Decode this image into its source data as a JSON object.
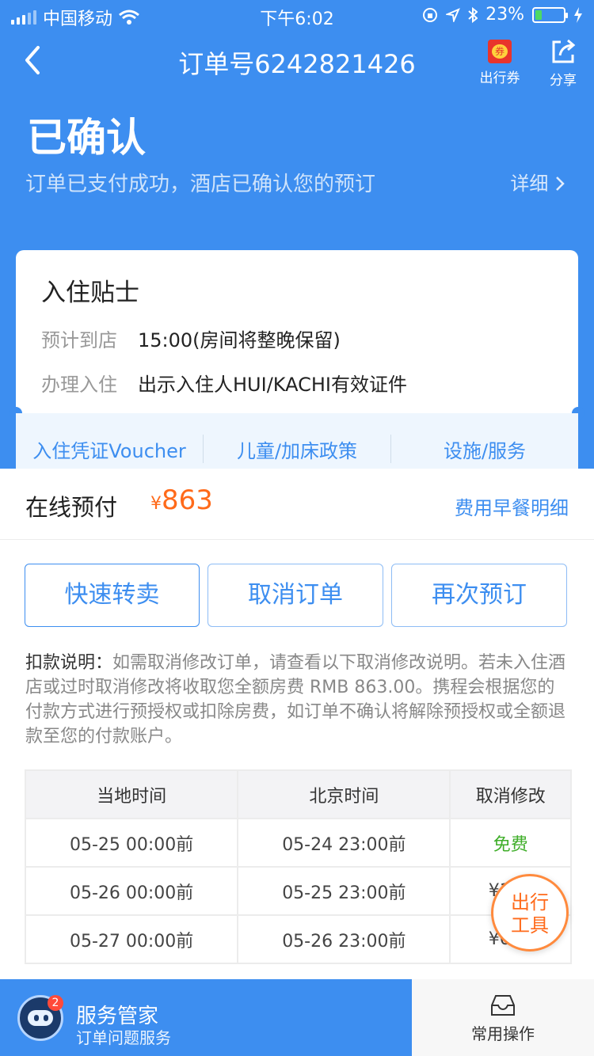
{
  "status_bar": {
    "carrier": "中国移动",
    "time": "下午6:02",
    "battery": "23%",
    "battery_level": 0.23
  },
  "nav": {
    "title": "订单号6242821426",
    "coupon_label": "出行券",
    "coupon_icon_text": "券",
    "share_label": "分享"
  },
  "order_status": {
    "title": "已确认",
    "description": "订单已支付成功，酒店已确认您的预订",
    "detail_link": "详细"
  },
  "checkin_tips": {
    "title": "入住贴士",
    "arrival_label": "预计到店",
    "arrival_value": "15:00(房间将整晚保留)",
    "checkin_label": "办理入住",
    "checkin_value": "出示入住人HUI/KACHI有效证件",
    "links": [
      "入住凭证Voucher",
      "儿童/加床政策",
      "设施/服务"
    ]
  },
  "payment": {
    "label": "在线预付",
    "currency": "¥",
    "amount": "863",
    "detail_link": "费用早餐明细"
  },
  "actions": [
    "快速转卖",
    "取消订单",
    "再次预订"
  ],
  "deduction": {
    "title": "扣款说明：",
    "text": "如需取消修改订单，请查看以下取消修改说明。若未入住酒店或过时取消修改将收取您全额房费 RMB 863.00。携程会根据您的付款方式进行预授权或扣除房费，如订单不确认将解除预授权或全额退款至您的付款账户。"
  },
  "policy_table": {
    "headers": [
      "当地时间",
      "北京时间",
      "取消修改"
    ],
    "rows": [
      [
        "05-25 00:00前",
        "05-24 23:00前",
        "免费"
      ],
      [
        "05-26 00:00前",
        "05-25 23:00前",
        "¥173"
      ],
      [
        "05-27 00:00前",
        "05-26 23:00前",
        "¥691"
      ]
    ]
  },
  "floating_tool": {
    "line1": "出行",
    "line2": "工具"
  },
  "bottom_bar": {
    "badge": "2",
    "butler_title": "服务管家",
    "butler_subtitle": "订单问题服务",
    "ops_label": "常用操作"
  },
  "colors": {
    "primary": "#3d8ef0",
    "price": "#ff6a1a",
    "free": "#3fae29"
  }
}
